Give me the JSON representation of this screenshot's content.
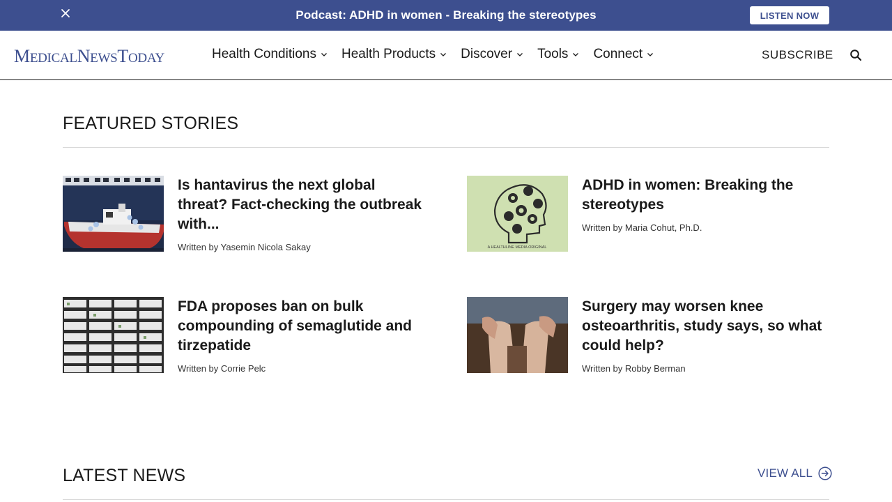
{
  "promo": {
    "text": "Podcast: ADHD in women - Breaking the stereotypes",
    "button_label": "LISTEN NOW",
    "close_icon": "close-icon",
    "background": "#3d4f8f"
  },
  "header": {
    "logo": {
      "m": "M",
      "edical": "EDICAL",
      "n": "N",
      "ews": "EWS",
      "t": "T",
      "oday": "ODAY"
    },
    "nav": [
      {
        "label": "Health Conditions"
      },
      {
        "label": "Health Products"
      },
      {
        "label": "Discover"
      },
      {
        "label": "Tools"
      },
      {
        "label": "Connect"
      }
    ],
    "subscribe_label": "SUBSCRIBE",
    "search_icon": "search-icon"
  },
  "featured": {
    "title": "FEATURED STORIES",
    "stories": [
      {
        "headline": "Is hantavirus the next global threat? Fact-checking the outbreak with...",
        "byline": "Written by Yasemin Nicola Sakay",
        "thumb": "cruise-ship-photo"
      },
      {
        "headline": "ADHD in women: Breaking the stereotypes",
        "byline": "Written by Maria Cohut, Ph.D.",
        "thumb": "podcast-artwork",
        "thumb_caption": "A HEALTHLINE MEDIA ORIGINAL"
      },
      {
        "headline": "FDA proposes ban on bulk compounding of semaglutide and tirzepatide",
        "byline": "Written by Corrie Pelc",
        "thumb": "medication-vials-photo"
      },
      {
        "headline": "Surgery may worsen knee osteoarthritis, study says, so what could help?",
        "byline": "Written by Robby Berman",
        "thumb": "knee-photo"
      }
    ]
  },
  "latest": {
    "title": "LATEST NEWS",
    "view_all_label": "VIEW ALL"
  },
  "colors": {
    "brand": "#3d4f8f",
    "text": "#1a1a1a",
    "divider": "#d9d9d9"
  }
}
